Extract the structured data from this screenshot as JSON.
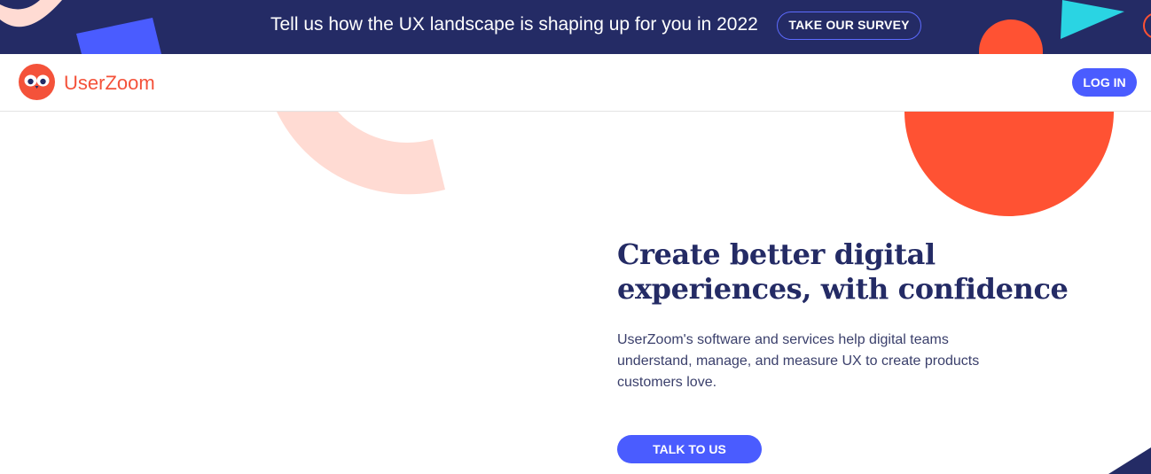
{
  "banner": {
    "text": "Tell us how the UX landscape is shaping up for you in 2022",
    "cta_label": "TAKE OUR SURVEY",
    "background_color": "#242b65"
  },
  "header": {
    "logo_text": "UserZoom",
    "login_label": "LOG IN"
  },
  "hero": {
    "title": "Create better digital experiences, with confidence",
    "description": "UserZoom's software and services help digital teams understand, manage, and measure UX to create products customers love.",
    "cta_label": "TALK TO US"
  },
  "colors": {
    "brand_orange": "#f4523a",
    "accent_blue": "#4a5cff",
    "navy": "#242b65",
    "peach": "#ffdbd3",
    "cyan": "#2ad4e3"
  }
}
